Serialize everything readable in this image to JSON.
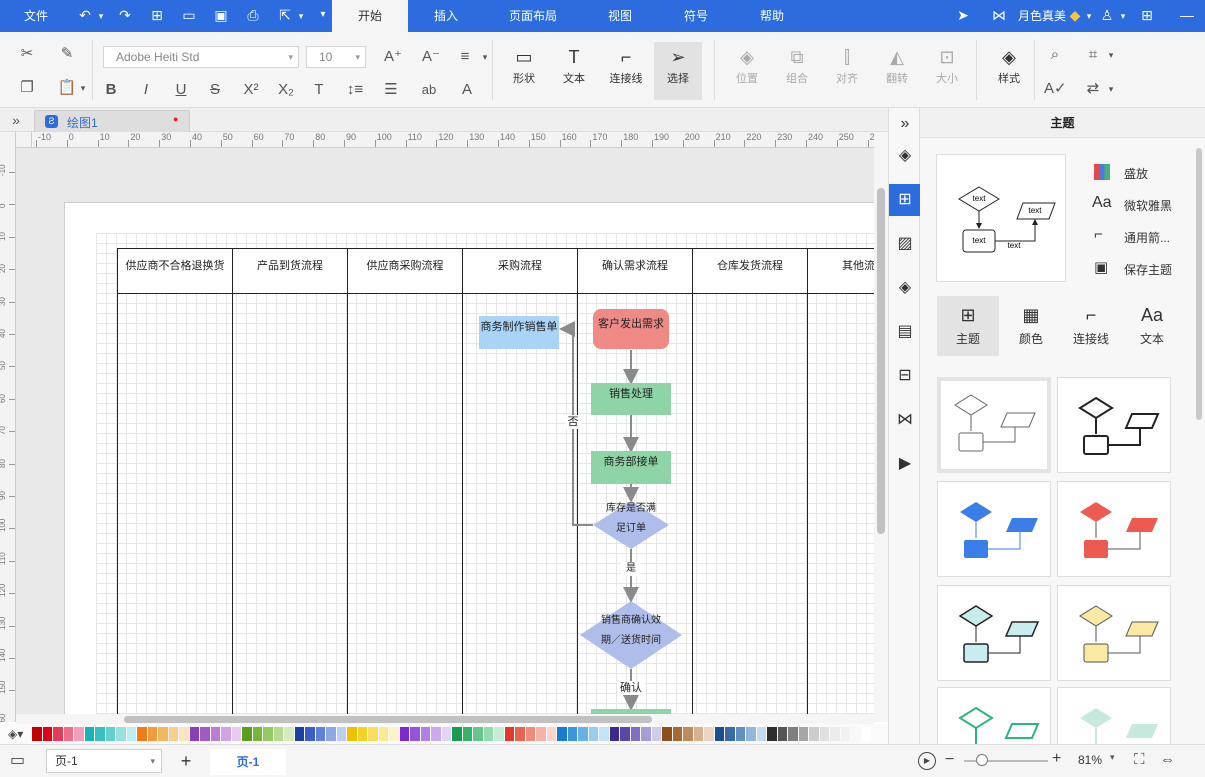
{
  "menu": {
    "file": "文件",
    "tabs": [
      "开始",
      "插入",
      "页面布局",
      "视图",
      "符号",
      "帮助"
    ],
    "active_tab": "开始",
    "user": "月色真美"
  },
  "ribbon": {
    "font_name": "Adobe Heiti Std",
    "font_size": "10",
    "buttons": {
      "shape": "形状",
      "text": "文本",
      "connector": "连接线",
      "select": "选择",
      "position": "位置",
      "group": "组合",
      "align": "对齐",
      "flip": "翻转",
      "size": "大小",
      "style": "样式"
    }
  },
  "doc": {
    "tab_name": "绘图1",
    "dirty_dot": "●"
  },
  "ruler": {
    "h_ticks": [
      "-10",
      "0",
      "10",
      "20",
      "30",
      "40",
      "50",
      "60",
      "70",
      "80",
      "90",
      "100",
      "110",
      "120",
      "130",
      "140",
      "150",
      "160",
      "170",
      "180",
      "190",
      "200",
      "210",
      "220",
      "230",
      "240",
      "250",
      "260"
    ],
    "v_ticks": [
      "-10",
      "0",
      "10",
      "20",
      "30",
      "40",
      "50",
      "60",
      "70",
      "80",
      "90",
      "100",
      "110",
      "120",
      "130",
      "140",
      "150",
      "160"
    ]
  },
  "diagram": {
    "lanes": [
      "供应商不合格退换货",
      "产品到货流程",
      "供应商采购流程",
      "采购流程",
      "确认需求流程",
      "仓库发货流程",
      "其他流"
    ],
    "nodes": {
      "customer": "客户发出需求",
      "sales_process": "销售处理",
      "business_accept": "商务部接单",
      "stock_check_1": "库存是否满",
      "stock_check_2": "足订单",
      "sales_order": "商务制作销售单",
      "confirm_1": "销售商确认效",
      "confirm_2": "期／送货时间",
      "label_no": "否",
      "label_yes": "是",
      "label_confirm": "确认"
    },
    "colors": {
      "customer": "#f08a87",
      "green": "#8fd4a6",
      "diamond": "#aebde9",
      "sales_order": "#a9d3f7"
    }
  },
  "panel": {
    "title": "主题",
    "options": [
      "盛放",
      "微软雅黑",
      "通用箭...",
      "保存主题"
    ],
    "tabs": [
      "主题",
      "颜色",
      "连接线",
      "文本"
    ],
    "preview_text": [
      "text",
      "text",
      "text",
      "text"
    ]
  },
  "statusbar": {
    "page_select": "页-1",
    "page_tab": "页-1",
    "zoom": "81%"
  },
  "palette": [
    "#c00000",
    "#e0001a",
    "#e83a57",
    "#f06c88",
    "#f3a0b6",
    "#1ab3b3",
    "#38c0c0",
    "#62cfcf",
    "#96e0e0",
    "#c0eded",
    "#f07d1a",
    "#f39a3c",
    "#f6b660",
    "#f9cd8d",
    "#fbe3bd",
    "#8a3fb3",
    "#a05ac4",
    "#b97ed2",
    "#d1a5e2",
    "#e6cbee",
    "#5a9d1e",
    "#76b63a",
    "#95c964",
    "#b6db8f",
    "#d6ebbd",
    "#1d3ea8",
    "#3a5ec9",
    "#6181d9",
    "#8ea6e6",
    "#bfcdf2",
    "#f0c000",
    "#f5d227",
    "#f8de5c",
    "#fbe994",
    "#fdf3c6",
    "#7a2ad0",
    "#9552dc",
    "#b07fe6",
    "#caa9ef",
    "#e3d3f7",
    "#1a9b50",
    "#39b269",
    "#63c68a",
    "#96dab0",
    "#c5ecd5",
    "#e03a2a",
    "#e8634f",
    "#ef8b7a",
    "#f5b3a7",
    "#fad6cf",
    "#1a7ad0",
    "#3c96dd",
    "#67b1e6",
    "#97cbef",
    "#c5e3f7",
    "#3e2a8e",
    "#5b47a8",
    "#7f6fc2",
    "#a79cd9",
    "#d0caed",
    "#8e4f1a",
    "#a76a34",
    "#c08a5a",
    "#d8b08d",
    "#ecd6c2",
    "#1a4e8e",
    "#3a6aa8",
    "#6190c2",
    "#93b7d9",
    "#c6dbed",
    "#2e2e2e",
    "#555555",
    "#7f7f7f",
    "#a6a6a6",
    "#cccccc",
    "#e0e0e0",
    "#ebebeb",
    "#f2f2f2",
    "#f8f8f8",
    "#ffffff"
  ]
}
